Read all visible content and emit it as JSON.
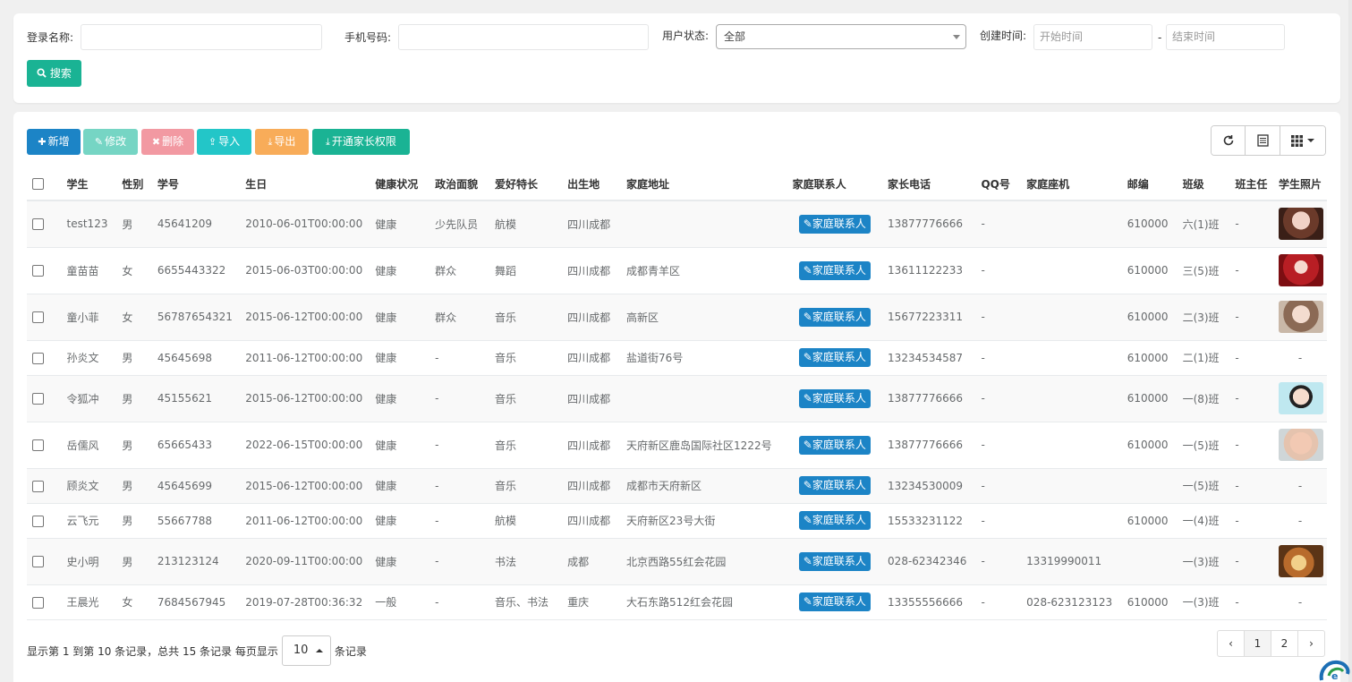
{
  "search": {
    "login_label": "登录名称:",
    "phone_label": "手机号码:",
    "status_label": "用户状态:",
    "status_value": "全部",
    "created_label": "创建时间:",
    "start_placeholder": "开始时间",
    "end_placeholder": "结束时间",
    "range_dash": "-",
    "search_button": "搜索"
  },
  "toolbar": {
    "add": "新增",
    "edit": "修改",
    "delete": "删除",
    "import": "导入",
    "export": "导出",
    "open_parent": "开通家长权限"
  },
  "colors": {
    "primary": "#1ab394",
    "blue": "#1c84c6",
    "info": "#23c6c8",
    "warning": "#f8ac59",
    "danger": "#ed5565"
  },
  "table": {
    "headers": [
      "学生",
      "性别",
      "学号",
      "生日",
      "健康状况",
      "政治面貌",
      "爱好特长",
      "出生地",
      "家庭地址",
      "家庭联系人",
      "家长电话",
      "QQ号",
      "家庭座机",
      "邮编",
      "班级",
      "班主任",
      "学生照片"
    ],
    "contact_button": "家庭联系人",
    "rows": [
      {
        "name": "test123",
        "sex": "男",
        "sid": "45641209",
        "birthday": "2010-06-01T00:00:00",
        "health": "健康",
        "political": "少先队员",
        "hobby": "航模",
        "birthplace": "四川成都",
        "address": "",
        "phone": "13877776666",
        "qq": "-",
        "landline": "",
        "zip": "610000",
        "class": "六(1)班",
        "teacher": "-",
        "photo": "woman-portrait"
      },
      {
        "name": "童苗苗",
        "sex": "女",
        "sid": "6655443322",
        "birthday": "2015-06-03T00:00:00",
        "health": "健康",
        "political": "群众",
        "hobby": "舞蹈",
        "birthplace": "四川成都",
        "address": "成都青羊区",
        "phone": "13611122233",
        "qq": "-",
        "landline": "",
        "zip": "610000",
        "class": "三(5)班",
        "teacher": "-",
        "photo": "red-portrait"
      },
      {
        "name": "童小菲",
        "sex": "女",
        "sid": "56787654321",
        "birthday": "2015-06-12T00:00:00",
        "health": "健康",
        "political": "群众",
        "hobby": "音乐",
        "birthplace": "四川成都",
        "address": "高新区",
        "phone": "15677223311",
        "qq": "-",
        "landline": "",
        "zip": "610000",
        "class": "二(3)班",
        "teacher": "-",
        "photo": "woman-portrait-2"
      },
      {
        "name": "孙炎文",
        "sex": "男",
        "sid": "45645698",
        "birthday": "2011-06-12T00:00:00",
        "health": "健康",
        "political": "-",
        "hobby": "音乐",
        "birthplace": "四川成都",
        "address": "盐道街76号",
        "phone": "13234534587",
        "qq": "-",
        "landline": "",
        "zip": "610000",
        "class": "二(1)班",
        "teacher": "-",
        "photo": "-"
      },
      {
        "name": "令狐冲",
        "sex": "男",
        "sid": "45155621",
        "birthday": "2015-06-12T00:00:00",
        "health": "健康",
        "political": "-",
        "hobby": "音乐",
        "birthplace": "四川成都",
        "address": "",
        "phone": "13877776666",
        "qq": "-",
        "landline": "",
        "zip": "610000",
        "class": "一(8)班",
        "teacher": "-",
        "photo": "child-portrait"
      },
      {
        "name": "岳儒风",
        "sex": "男",
        "sid": "65665433",
        "birthday": "2022-06-15T00:00:00",
        "health": "健康",
        "political": "-",
        "hobby": "音乐",
        "birthplace": "四川成都",
        "address": "天府新区鹿岛国际社区1222号",
        "phone": "13877776666",
        "qq": "-",
        "landline": "",
        "zip": "610000",
        "class": "一(5)班",
        "teacher": "-",
        "photo": "baby-portrait"
      },
      {
        "name": "顾炎文",
        "sex": "男",
        "sid": "45645699",
        "birthday": "2015-06-12T00:00:00",
        "health": "健康",
        "political": "-",
        "hobby": "音乐",
        "birthplace": "四川成都",
        "address": "成都市天府新区",
        "phone": "13234530009",
        "qq": "-",
        "landline": "",
        "zip": "",
        "class": "一(5)班",
        "teacher": "-",
        "photo": "-"
      },
      {
        "name": "云飞元",
        "sex": "男",
        "sid": "55667788",
        "birthday": "2011-06-12T00:00:00",
        "health": "健康",
        "political": "-",
        "hobby": "航模",
        "birthplace": "四川成都",
        "address": "天府新区23号大街",
        "phone": "15533231122",
        "qq": "-",
        "landline": "",
        "zip": "610000",
        "class": "一(4)班",
        "teacher": "-",
        "photo": "-"
      },
      {
        "name": "史小明",
        "sex": "男",
        "sid": "213123124",
        "birthday": "2020-09-11T00:00:00",
        "health": "健康",
        "political": "-",
        "hobby": "书法",
        "birthplace": "成都",
        "address": "北京西路55红会花园",
        "phone": "028-62342346",
        "qq": "-",
        "landline": "13319990011",
        "zip": "",
        "class": "一(3)班",
        "teacher": "-",
        "photo": "cat-photo"
      },
      {
        "name": "王晨光",
        "sex": "女",
        "sid": "7684567945",
        "birthday": "2019-07-28T00:36:32",
        "health": "一般",
        "political": "-",
        "hobby": "音乐、书法",
        "birthplace": "重庆",
        "address": "大石东路512红会花园",
        "phone": "13355556666",
        "qq": "-",
        "landline": "028-623123123",
        "zip": "610000",
        "class": "一(3)班",
        "teacher": "-",
        "photo": "-"
      }
    ]
  },
  "pager": {
    "info": "显示第 1 到第 10 条记录，总共 15 条记录 每页显示",
    "page_size": "10",
    "suffix": "条记录",
    "prev": "‹",
    "pages": [
      "1",
      "2"
    ],
    "next": "›"
  }
}
